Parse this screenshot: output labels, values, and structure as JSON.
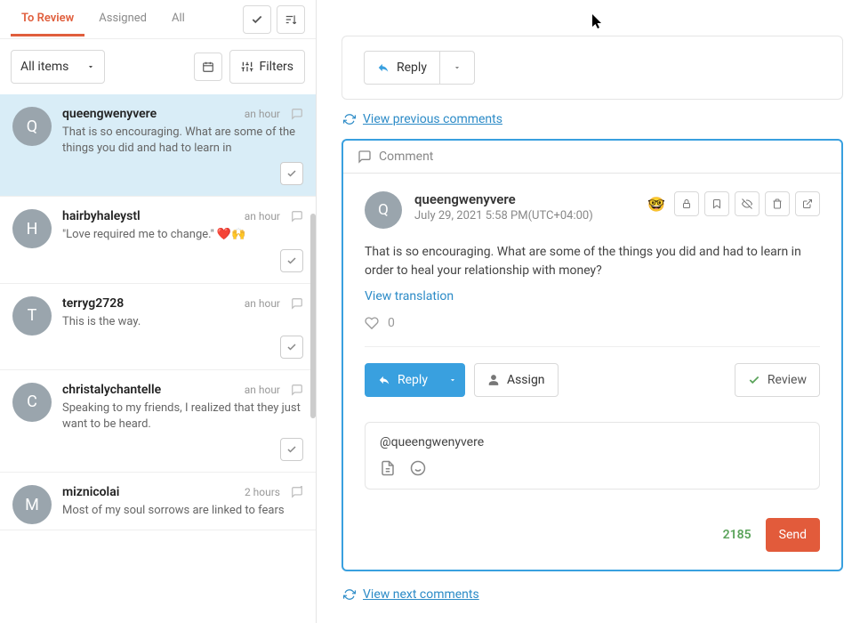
{
  "tabs": {
    "to_review": "To Review",
    "assigned": "Assigned",
    "all": "All"
  },
  "toolbar": {
    "items": "All items",
    "filters": "Filters"
  },
  "sidebar_items": [
    {
      "letter": "Q",
      "name": "queengwenyvere",
      "time": "an hour",
      "preview": "That is so encouraging. What are some of the things you did and had to learn in"
    },
    {
      "letter": "H",
      "name": "hairbyhaleystl",
      "time": "an hour",
      "preview": "\"Love required me to change.\" ❤️🙌"
    },
    {
      "letter": "T",
      "name": "terryg2728",
      "time": "an hour",
      "preview": "This is the way."
    },
    {
      "letter": "C",
      "name": "christalychantelle",
      "time": "an hour",
      "preview": "Speaking to my friends, I realized that they just want to be heard."
    },
    {
      "letter": "M",
      "name": "miznicolai",
      "time": "2 hours",
      "preview": "Most of my soul sorrows are linked to fears"
    }
  ],
  "reply_btn": "Reply",
  "view_prev": "View previous comments",
  "view_next": "View next comments",
  "comment": {
    "label": "Comment",
    "avatar_letter": "Q",
    "name": "queengwenyvere",
    "date": "July 29, 2021 5:58 PM(UTC+04:00)",
    "body": "That is so encouraging. What are some of the things you did and had to learn in order to heal your relationship with money?",
    "translate": "View translation",
    "likes": "0",
    "sentiment_emoji": "🤓",
    "assign": "Assign",
    "review": "Review"
  },
  "compose": {
    "mention": "@queengwenyvere",
    "counter": "2185",
    "send": "Send"
  }
}
